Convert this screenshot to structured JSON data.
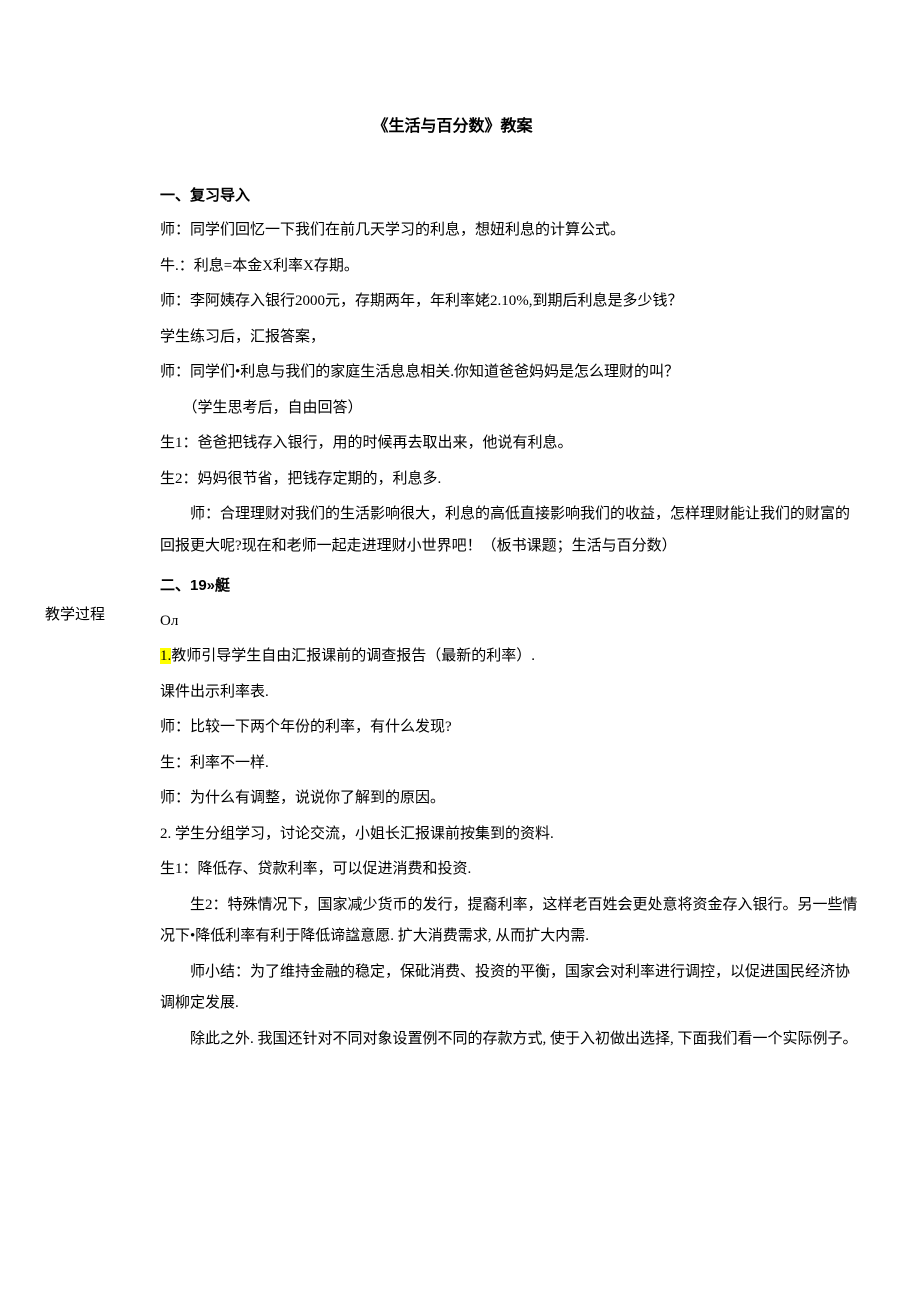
{
  "title": "《生活与百分数》教案",
  "side_label": "教学过程",
  "section1": {
    "heading": "一、复习导入",
    "lines": [
      "师：同学们回忆一下我们在前几天学习的利息，想妞利息的计算公式。",
      "牛.：利息=本金X利率X存期。",
      "师：李阿姨存入银行2000元，存期两年，年利率姥2.10%,到期后利息是多少钱？",
      "学生练习后，汇报答案，",
      "师：同学们•利息与我们的家庭生活息息相关.你知道爸爸妈妈是怎么理财的叫？",
      "（学生思考后，自由回答）",
      "生1：爸爸把钱存入银行，用的时候再去取出来，他说有利息。",
      "生2：妈妈很节省，把钱存定期的，利息多.",
      "师：合理理财对我们的生活影响很大，利息的高低直接影响我们的收益，怎样理财能让我们的财富的回报更大呢?现在和老师一起走进理财小世界吧！（板书课题；生活与百分数）"
    ]
  },
  "section2": {
    "heading": "二、19»艇",
    "sub_heading": "Oл",
    "hl_prefix": "1.",
    "hl_rest": "教师引导学生自由汇报课前的调查报告（最新的利率）.",
    "lines": [
      "课件出示利率表.",
      "师：比较一下两个年份的利率，有什么发现?",
      "生：利率不一样.",
      "师：为什么有调整，说说你了解到的原因。",
      "2. 学生分组学习，讨论交流，小姐长汇报课前按集到的资料.",
      "生1：降低存、贷款利率，可以促进消费和投资.",
      "生2：特殊情况下，国家减少货币的发行，提裔利率，这样老百姓会更处意将资金存入银行。另一些情况下•降低利率有利于降低谛諡意愿. 扩大消费需求, 从而扩大内需.",
      "师小结：为了维持金融的稳定，保砒消费、投资的平衡，国家会对利率进行调控，以促进国民经济协调柳定发展.",
      "除此之外. 我国还针对不同对象设置例不同的存款方式, 使于入初做出选择, 下面我们看一个实际例子。"
    ]
  }
}
